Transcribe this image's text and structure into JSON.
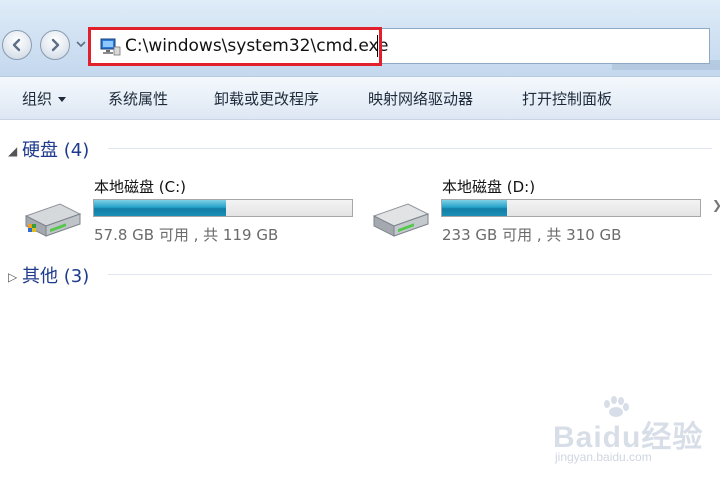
{
  "address_bar": {
    "path": "C:\\windows\\system32\\cmd.exe",
    "highlight_color": "#e0202b",
    "icon": "computer-icon"
  },
  "navigation": {
    "back_icon": "back-arrow-icon",
    "forward_icon": "forward-arrow-icon",
    "history_icon": "chevron-down-icon"
  },
  "command_bar": {
    "organize": "组织",
    "system_properties": "系统属性",
    "uninstall": "卸载或更改程序",
    "map_drive": "映射网络驱动器",
    "control_panel": "打开控制面板"
  },
  "groups": {
    "hard_disks": {
      "label": "硬盘 (4)"
    },
    "other": {
      "label": "其他 (3)"
    }
  },
  "drives": [
    {
      "name": "本地磁盘 (C:)",
      "size_text": "57.8 GB 可用 , 共 119 GB",
      "used_fraction": 0.51,
      "icon": "system-drive-icon"
    },
    {
      "name": "本地磁盘 (D:)",
      "size_text": "233 GB 可用 , 共 310 GB",
      "used_fraction": 0.25,
      "icon": "hard-drive-icon"
    }
  ],
  "watermark": {
    "brand": "Baidu经验",
    "url": "jingyan.baidu.com"
  },
  "colors": {
    "group_header": "#1e3a8c",
    "progress_fill": "#1b8fb6",
    "toolbar_bg": "#e9f0f8"
  }
}
